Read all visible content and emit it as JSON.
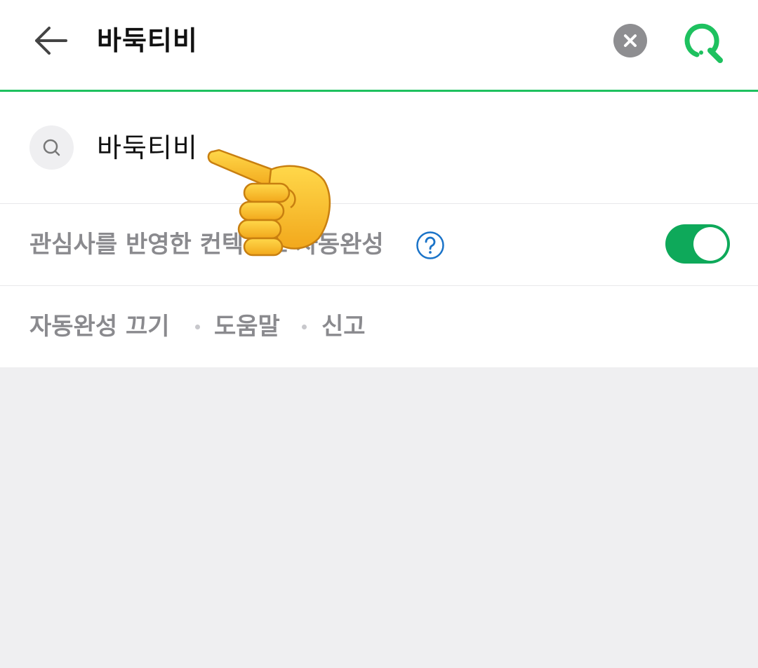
{
  "header": {
    "query": "바둑티비",
    "back_icon": "arrow-left-icon",
    "clear_icon": "close-circle-icon",
    "search_icon": "search-icon"
  },
  "suggestions": [
    {
      "icon": "search-icon",
      "text": "바둑티비"
    }
  ],
  "autocomplete_setting": {
    "label": "관심사를 반영한 컨텍스트 자동완성",
    "help_icon": "help-circle-icon",
    "toggle_on": true
  },
  "footer_links": {
    "turn_off": "자동완성 끄기",
    "help": "도움말",
    "report": "신고"
  },
  "overlay": {
    "icon": "pointing-hand-emoji"
  },
  "colors": {
    "accent": "#1ec15f",
    "toggle": "#0ea95a",
    "help": "#1a73c8",
    "muted_text": "#8a8a8e",
    "background": "#efeff1"
  }
}
